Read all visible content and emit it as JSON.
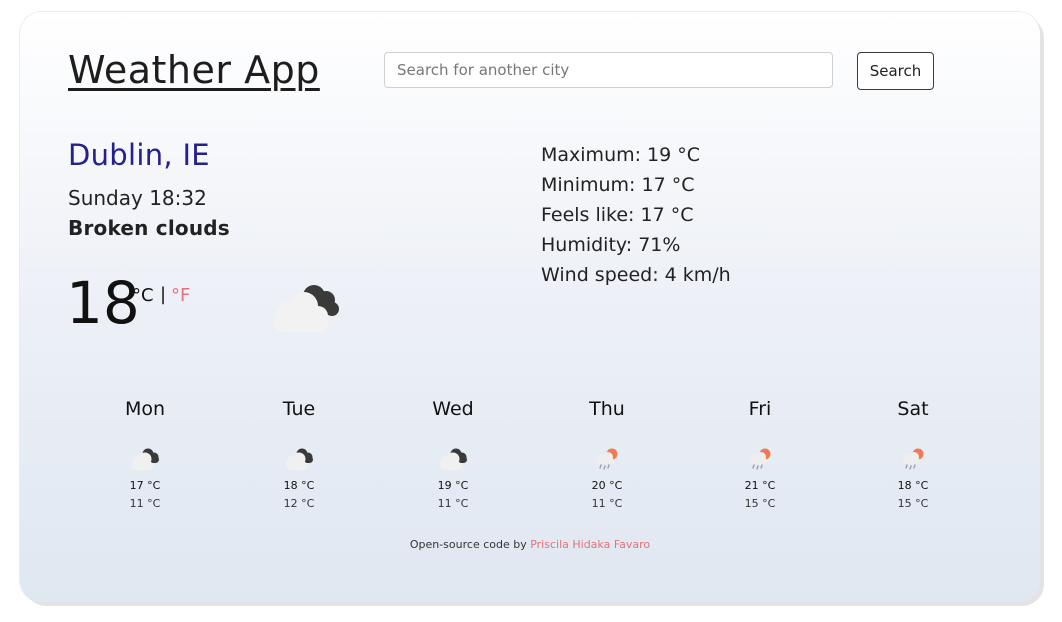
{
  "header": {
    "title": "Weather App",
    "search_placeholder": "Search for another city",
    "search_value": "",
    "search_button_label": "Search"
  },
  "current": {
    "city": "Dublin, IE",
    "datetime": "Sunday 18:32",
    "description": "Broken clouds",
    "temperature": "18",
    "unit_celsius": "°C",
    "unit_separator": "|",
    "unit_fahrenheit": "°F",
    "icon": "broken-clouds-icon"
  },
  "details": {
    "maximum": "Maximum: 19 °C",
    "minimum": "Minimum: 17 °C",
    "feels_like": "Feels like: 17 °C",
    "humidity": "Humidity: 71%",
    "wind_speed": "Wind speed: 4 km/h"
  },
  "forecast": [
    {
      "day": "Mon",
      "max": "17 °C",
      "min": "11 °C",
      "icon": "broken-clouds-icon"
    },
    {
      "day": "Tue",
      "max": "18 °C",
      "min": "12 °C",
      "icon": "broken-clouds-icon"
    },
    {
      "day": "Wed",
      "max": "19 °C",
      "min": "11 °C",
      "icon": "broken-clouds-icon"
    },
    {
      "day": "Thu",
      "max": "20 °C",
      "min": "11 °C",
      "icon": "sun-rain-icon"
    },
    {
      "day": "Fri",
      "max": "21 °C",
      "min": "15 °C",
      "icon": "sun-rain-icon"
    },
    {
      "day": "Sat",
      "max": "18 °C",
      "min": "15 °C",
      "icon": "sun-rain-icon"
    }
  ],
  "footer": {
    "prefix": "Open-source code by ",
    "author": "Priscila Hidaka Favaro"
  },
  "colors": {
    "city": "#24218c",
    "accent": "#e0737b",
    "cloud_dark": "#3a3a3a",
    "cloud_light": "#f2f2f2",
    "sun": "#f07a52",
    "rain": "#9aa3ad"
  }
}
